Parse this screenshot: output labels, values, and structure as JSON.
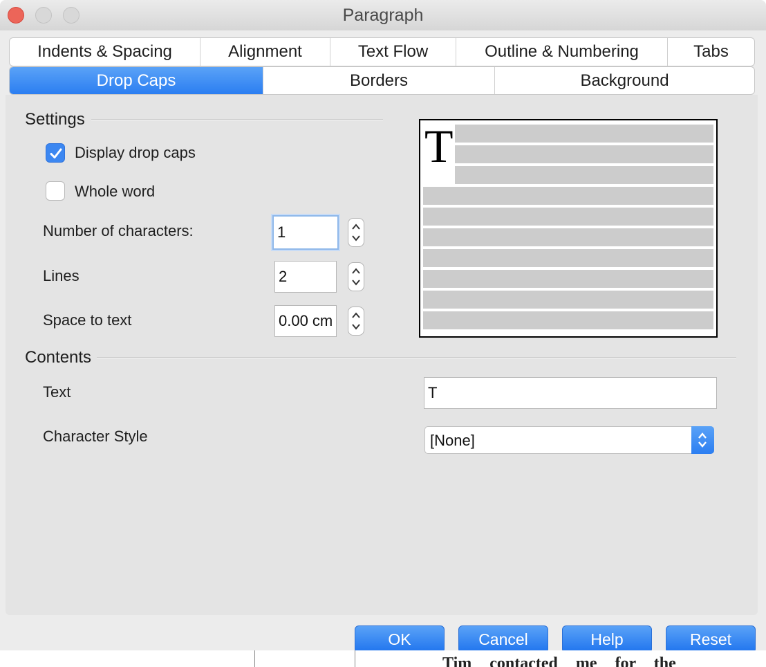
{
  "window": {
    "title": "Paragraph"
  },
  "tabs_row1": [
    {
      "label": "Indents & Spacing"
    },
    {
      "label": "Alignment"
    },
    {
      "label": "Text Flow"
    },
    {
      "label": "Outline & Numbering"
    },
    {
      "label": "Tabs"
    }
  ],
  "tabs_row2": [
    {
      "label": "Drop Caps",
      "selected": true
    },
    {
      "label": "Borders"
    },
    {
      "label": "Background"
    }
  ],
  "settings": {
    "heading": "Settings",
    "display_drop_caps": {
      "label": "Display drop caps",
      "checked": true
    },
    "whole_word": {
      "label": "Whole word",
      "checked": false
    },
    "number_of_characters": {
      "label": "Number of characters:",
      "value": "1"
    },
    "lines": {
      "label": "Lines",
      "value": "2"
    },
    "space_to_text": {
      "label": "Space to text",
      "value": "0.00 cm"
    }
  },
  "preview": {
    "drop_cap_letter": "T"
  },
  "contents": {
    "heading": "Contents",
    "text": {
      "label": "Text",
      "value": "T"
    },
    "character_style": {
      "label": "Character Style",
      "value": "[None]"
    }
  },
  "buttons": {
    "ok": "OK",
    "cancel": "Cancel",
    "help": "Help",
    "reset": "Reset"
  },
  "background_document": {
    "partial_text": "Tim contacted me for the"
  },
  "colors": {
    "accent": "#2b7ef1",
    "close": "#ec6559",
    "panel": "#e4e4e4",
    "preview_line": "#cccccc"
  }
}
